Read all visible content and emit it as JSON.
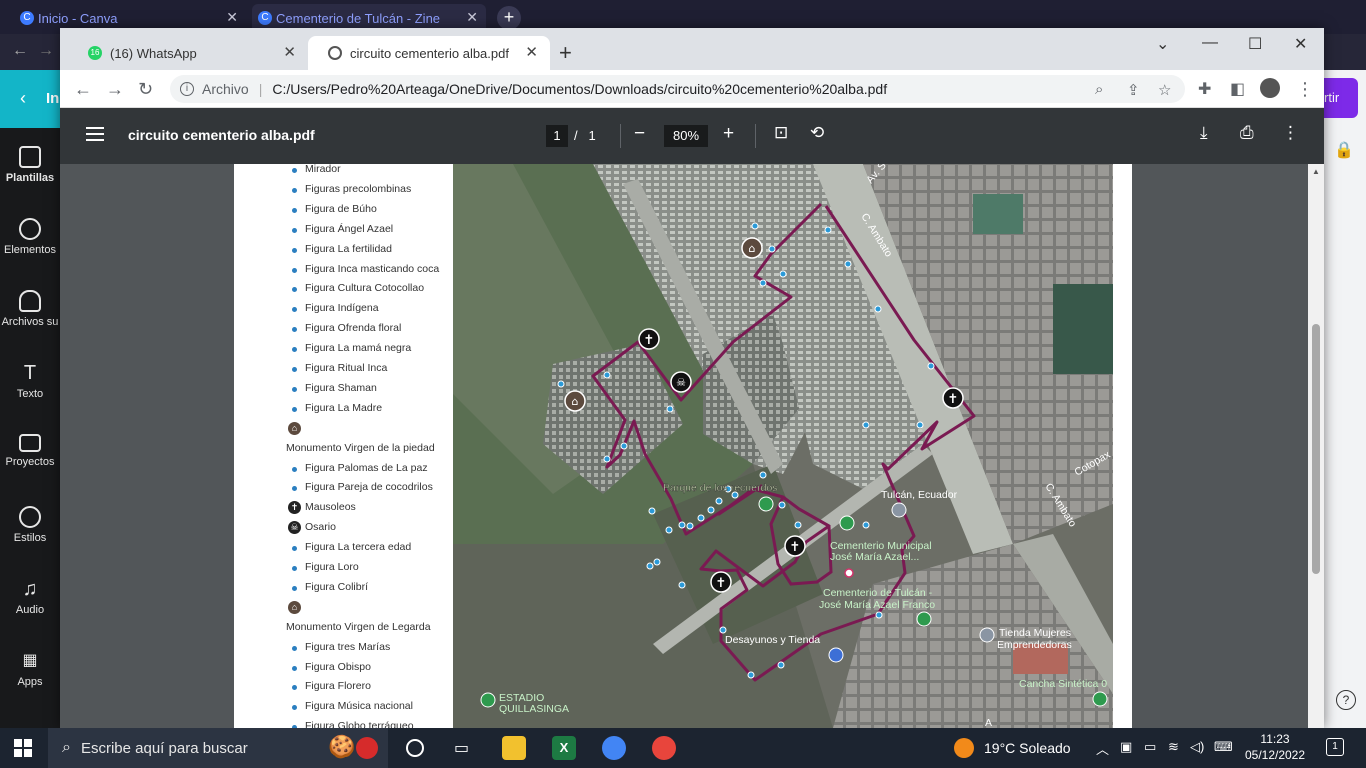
{
  "background_window": {
    "tabs": [
      {
        "label": "Inicio - Canva"
      },
      {
        "label": "Cementerio de Tulcán - Zine"
      }
    ],
    "canva_back_label": "In",
    "share_label": "rtir",
    "sidebar": [
      {
        "label": "Plantillas",
        "icon": "template-icon"
      },
      {
        "label": "Elementos",
        "icon": "shapes-icon"
      },
      {
        "label": "Archivos su",
        "icon": "upload-icon"
      },
      {
        "label": "Texto",
        "icon": "text-icon"
      },
      {
        "label": "Proyectos",
        "icon": "folder-icon"
      },
      {
        "label": "Estilos",
        "icon": "palette-icon"
      },
      {
        "label": "Audio",
        "icon": "music-icon"
      },
      {
        "label": "Apps",
        "icon": "apps-grid-icon"
      }
    ]
  },
  "browser": {
    "tabs": [
      {
        "label": "(16) WhatsApp",
        "badge": "16",
        "active": false
      },
      {
        "label": "circuito cementerio alba.pdf",
        "active": true
      }
    ],
    "address": {
      "scheme_label": "Archivo",
      "url": "C:/Users/Pedro%20Arteaga/OneDrive/Documentos/Downloads/circuito%20cementerio%20alba.pdf"
    }
  },
  "pdf": {
    "title": "circuito cementerio alba.pdf",
    "page_current": "1",
    "page_separator": "/",
    "page_total": "1",
    "zoom": "80%"
  },
  "legend": {
    "items": [
      {
        "type": "dot",
        "label": "Mirador"
      },
      {
        "type": "dot",
        "label": "Figuras precolombinas"
      },
      {
        "type": "dot",
        "label": "Figura de Búho"
      },
      {
        "type": "dot",
        "label": "Figura Ángel Azael"
      },
      {
        "type": "dot",
        "label": "Figura La fertilidad"
      },
      {
        "type": "dot",
        "label": "Figura Inca masticando coca"
      },
      {
        "type": "dot",
        "label": "Figura Cultura Cotocollao"
      },
      {
        "type": "dot",
        "label": "Figura Indígena"
      },
      {
        "type": "dot",
        "label": "Figura Ofrenda floral"
      },
      {
        "type": "dot",
        "label": "Figura La mamá negra"
      },
      {
        "type": "dot",
        "label": "Figura Ritual Inca"
      },
      {
        "type": "dot",
        "label": "Figura Shaman"
      },
      {
        "type": "dot",
        "label": "Figura La Madre"
      },
      {
        "type": "monument",
        "label": ""
      },
      {
        "type": "heading",
        "label": "Monumento Virgen de la piedad"
      },
      {
        "type": "dot",
        "label": "Figura Palomas de La paz"
      },
      {
        "type": "dot",
        "label": "Figura Pareja de cocodrilos"
      },
      {
        "type": "cross",
        "label": "Mausoleos"
      },
      {
        "type": "skull",
        "label": "Osario"
      },
      {
        "type": "dot",
        "label": "Figura La tercera edad"
      },
      {
        "type": "dot",
        "label": "Figura Loro"
      },
      {
        "type": "dot",
        "label": "Figura Colibrí"
      },
      {
        "type": "monument",
        "label": ""
      },
      {
        "type": "heading",
        "label": "Monumento Virgen de Legarda"
      },
      {
        "type": "dot",
        "label": "Figura tres Marías"
      },
      {
        "type": "dot",
        "label": "Figura Obispo"
      },
      {
        "type": "dot",
        "label": "Figura Florero"
      },
      {
        "type": "dot",
        "label": "Figura Música nacional"
      },
      {
        "type": "dot",
        "label": "Figura Globo terráqueo"
      }
    ]
  },
  "map": {
    "route_color": "#7a1a52",
    "point_color": "#2b9ad8",
    "labels": {
      "av": "Av. S",
      "c_ambato_1": "C. Ambato",
      "c_ambato_2": "C. Ambato",
      "cotopaxi": "Cotopax",
      "parque": "Parque de los recuerdos",
      "tulcan": "Tulcán, Ecuador",
      "cementerio_municipal_1": "Cementerio Municipal",
      "cementerio_municipal_2": "José María Azael...",
      "cementerio_tulcan_1": "Cementerio de Tulcán -",
      "cementerio_tulcan_2": "José María Azael Franco",
      "desayunos": "Desayunos y Tienda",
      "tienda_1": "Tienda Mujeres",
      "tienda_2": "Emprendedoras",
      "cancha": "Cancha Sintética 0",
      "estadio_1": "ESTADIO",
      "estadio_2": "QUILLASINGA",
      "edge_a": "A"
    }
  },
  "taskbar": {
    "search_placeholder": "Escribe aquí para buscar",
    "weather": "19°C  Soleado",
    "time": "11:23",
    "date": "05/12/2022",
    "notifications": "1"
  }
}
